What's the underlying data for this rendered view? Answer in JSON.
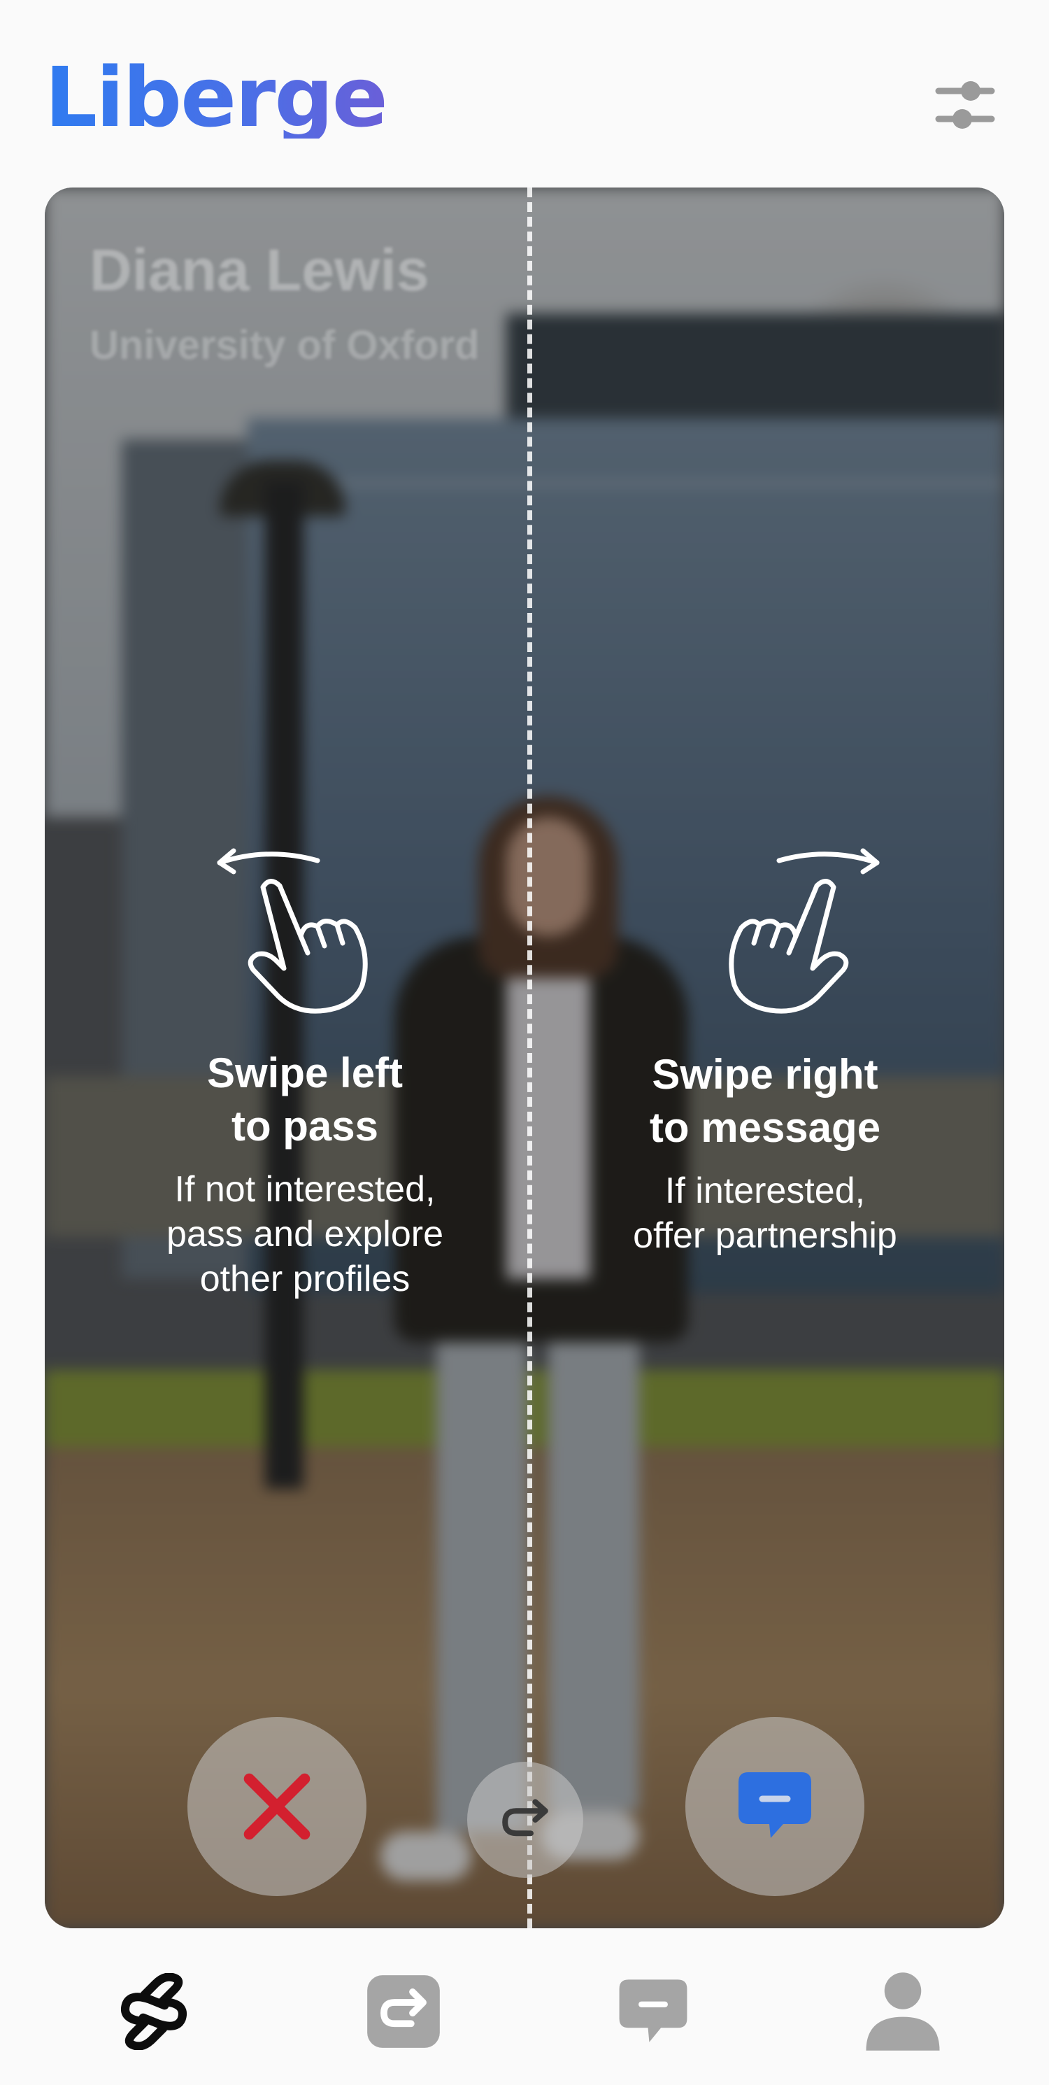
{
  "app": {
    "logo_text": "Liberge",
    "accent": "#2f7bf0"
  },
  "header": {
    "filter_icon": "sliders-icon"
  },
  "profile": {
    "name": "Diana Lewis",
    "university": "University of Oxford"
  },
  "hints": {
    "left": {
      "icon": "swipe-left-hand-icon",
      "title_line1": "Swipe left",
      "title_line2": "to pass",
      "desc_line1": "If not interested,",
      "desc_line2": "pass and explore",
      "desc_line3": "other profiles"
    },
    "right": {
      "icon": "swipe-right-hand-icon",
      "title_line1": "Swipe right",
      "title_line2": "to message",
      "desc_line1": "If interested,",
      "desc_line2": "offer partnership"
    }
  },
  "actions": [
    {
      "name": "pass",
      "icon": "close-x-icon",
      "color": "#d3202f"
    },
    {
      "name": "rewind",
      "icon": "undo-arrow-icon",
      "color": "#3a3a3a"
    },
    {
      "name": "message",
      "icon": "chat-bubble-icon",
      "color": "#2d6fe0"
    }
  ],
  "nav": [
    {
      "name": "connect",
      "icon": "link-icon",
      "active": true
    },
    {
      "name": "requests",
      "icon": "forward-arrow-icon",
      "active": false
    },
    {
      "name": "messages",
      "icon": "chat-icon",
      "active": false
    },
    {
      "name": "profile",
      "icon": "person-icon",
      "active": false
    }
  ]
}
